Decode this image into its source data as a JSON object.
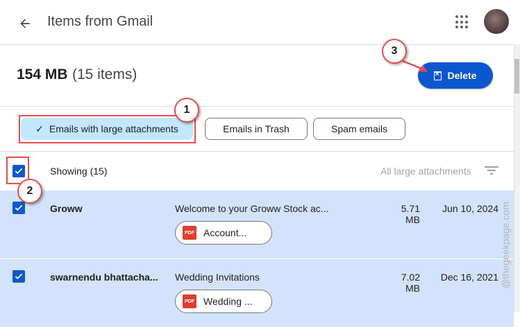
{
  "header": {
    "title": "Items from Gmail"
  },
  "summary": {
    "size": "154 MB",
    "count": "(15 items)"
  },
  "actions": {
    "delete_label": "Delete"
  },
  "filters": [
    {
      "label": "Emails with large attachments",
      "selected": true
    },
    {
      "label": "Emails in Trash",
      "selected": false
    },
    {
      "label": "Spam emails",
      "selected": false
    }
  ],
  "list_header": {
    "showing": "Showing (15)",
    "filter_label": "All large attachments"
  },
  "rows": [
    {
      "sender": "Groww",
      "subject": "Welcome to your Groww Stock ac...",
      "size": "5.71 MB",
      "date": "Jun 10, 2024",
      "attachment": "Account...",
      "attachment_type": "PDF",
      "checked": true
    },
    {
      "sender": "swarnendu bhattacha...",
      "subject": "Wedding Invitations",
      "size": "7.02 MB",
      "date": "Dec 16, 2021",
      "attachment": "Wedding ...",
      "attachment_type": "PDF",
      "checked": true
    }
  ],
  "annotations": {
    "badge1": "1",
    "badge2": "2",
    "badge3": "3",
    "accent": "#e84c4c"
  },
  "watermark": "@thegeekpage.com",
  "colors": {
    "primary": "#0b57d0",
    "selected_row": "#d3e3fd",
    "chip_selected": "#c2e7ff"
  }
}
